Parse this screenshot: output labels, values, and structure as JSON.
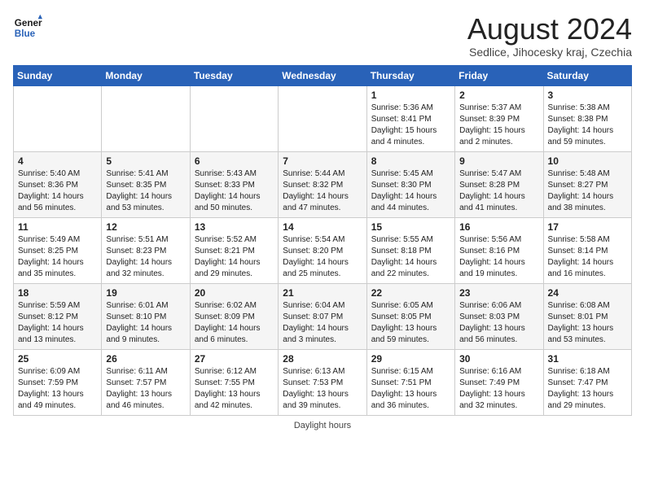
{
  "logo": {
    "line1": "General",
    "line2": "Blue"
  },
  "title": "August 2024",
  "location": "Sedlice, Jihocesky kraj, Czechia",
  "days_of_week": [
    "Sunday",
    "Monday",
    "Tuesday",
    "Wednesday",
    "Thursday",
    "Friday",
    "Saturday"
  ],
  "footer": "Daylight hours",
  "weeks": [
    [
      {
        "num": "",
        "info": ""
      },
      {
        "num": "",
        "info": ""
      },
      {
        "num": "",
        "info": ""
      },
      {
        "num": "",
        "info": ""
      },
      {
        "num": "1",
        "info": "Sunrise: 5:36 AM\nSunset: 8:41 PM\nDaylight: 15 hours\nand 4 minutes."
      },
      {
        "num": "2",
        "info": "Sunrise: 5:37 AM\nSunset: 8:39 PM\nDaylight: 15 hours\nand 2 minutes."
      },
      {
        "num": "3",
        "info": "Sunrise: 5:38 AM\nSunset: 8:38 PM\nDaylight: 14 hours\nand 59 minutes."
      }
    ],
    [
      {
        "num": "4",
        "info": "Sunrise: 5:40 AM\nSunset: 8:36 PM\nDaylight: 14 hours\nand 56 minutes."
      },
      {
        "num": "5",
        "info": "Sunrise: 5:41 AM\nSunset: 8:35 PM\nDaylight: 14 hours\nand 53 minutes."
      },
      {
        "num": "6",
        "info": "Sunrise: 5:43 AM\nSunset: 8:33 PM\nDaylight: 14 hours\nand 50 minutes."
      },
      {
        "num": "7",
        "info": "Sunrise: 5:44 AM\nSunset: 8:32 PM\nDaylight: 14 hours\nand 47 minutes."
      },
      {
        "num": "8",
        "info": "Sunrise: 5:45 AM\nSunset: 8:30 PM\nDaylight: 14 hours\nand 44 minutes."
      },
      {
        "num": "9",
        "info": "Sunrise: 5:47 AM\nSunset: 8:28 PM\nDaylight: 14 hours\nand 41 minutes."
      },
      {
        "num": "10",
        "info": "Sunrise: 5:48 AM\nSunset: 8:27 PM\nDaylight: 14 hours\nand 38 minutes."
      }
    ],
    [
      {
        "num": "11",
        "info": "Sunrise: 5:49 AM\nSunset: 8:25 PM\nDaylight: 14 hours\nand 35 minutes."
      },
      {
        "num": "12",
        "info": "Sunrise: 5:51 AM\nSunset: 8:23 PM\nDaylight: 14 hours\nand 32 minutes."
      },
      {
        "num": "13",
        "info": "Sunrise: 5:52 AM\nSunset: 8:21 PM\nDaylight: 14 hours\nand 29 minutes."
      },
      {
        "num": "14",
        "info": "Sunrise: 5:54 AM\nSunset: 8:20 PM\nDaylight: 14 hours\nand 25 minutes."
      },
      {
        "num": "15",
        "info": "Sunrise: 5:55 AM\nSunset: 8:18 PM\nDaylight: 14 hours\nand 22 minutes."
      },
      {
        "num": "16",
        "info": "Sunrise: 5:56 AM\nSunset: 8:16 PM\nDaylight: 14 hours\nand 19 minutes."
      },
      {
        "num": "17",
        "info": "Sunrise: 5:58 AM\nSunset: 8:14 PM\nDaylight: 14 hours\nand 16 minutes."
      }
    ],
    [
      {
        "num": "18",
        "info": "Sunrise: 5:59 AM\nSunset: 8:12 PM\nDaylight: 14 hours\nand 13 minutes."
      },
      {
        "num": "19",
        "info": "Sunrise: 6:01 AM\nSunset: 8:10 PM\nDaylight: 14 hours\nand 9 minutes."
      },
      {
        "num": "20",
        "info": "Sunrise: 6:02 AM\nSunset: 8:09 PM\nDaylight: 14 hours\nand 6 minutes."
      },
      {
        "num": "21",
        "info": "Sunrise: 6:04 AM\nSunset: 8:07 PM\nDaylight: 14 hours\nand 3 minutes."
      },
      {
        "num": "22",
        "info": "Sunrise: 6:05 AM\nSunset: 8:05 PM\nDaylight: 13 hours\nand 59 minutes."
      },
      {
        "num": "23",
        "info": "Sunrise: 6:06 AM\nSunset: 8:03 PM\nDaylight: 13 hours\nand 56 minutes."
      },
      {
        "num": "24",
        "info": "Sunrise: 6:08 AM\nSunset: 8:01 PM\nDaylight: 13 hours\nand 53 minutes."
      }
    ],
    [
      {
        "num": "25",
        "info": "Sunrise: 6:09 AM\nSunset: 7:59 PM\nDaylight: 13 hours\nand 49 minutes."
      },
      {
        "num": "26",
        "info": "Sunrise: 6:11 AM\nSunset: 7:57 PM\nDaylight: 13 hours\nand 46 minutes."
      },
      {
        "num": "27",
        "info": "Sunrise: 6:12 AM\nSunset: 7:55 PM\nDaylight: 13 hours\nand 42 minutes."
      },
      {
        "num": "28",
        "info": "Sunrise: 6:13 AM\nSunset: 7:53 PM\nDaylight: 13 hours\nand 39 minutes."
      },
      {
        "num": "29",
        "info": "Sunrise: 6:15 AM\nSunset: 7:51 PM\nDaylight: 13 hours\nand 36 minutes."
      },
      {
        "num": "30",
        "info": "Sunrise: 6:16 AM\nSunset: 7:49 PM\nDaylight: 13 hours\nand 32 minutes."
      },
      {
        "num": "31",
        "info": "Sunrise: 6:18 AM\nSunset: 7:47 PM\nDaylight: 13 hours\nand 29 minutes."
      }
    ]
  ]
}
